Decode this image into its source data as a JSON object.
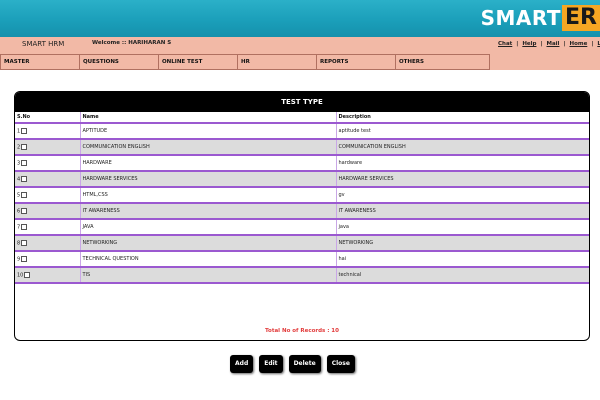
{
  "logo": {
    "part1": "SMART",
    "part2": "ER"
  },
  "header": {
    "app_name": "SMART HRM",
    "welcome": "Welcome :: HARIHARAN S",
    "links": [
      "Chat",
      "Help",
      "Mail",
      "Home",
      "L"
    ]
  },
  "menu": [
    {
      "label": "MASTER"
    },
    {
      "label": "QUESTIONS"
    },
    {
      "label": "ONLINE TEST"
    },
    {
      "label": "HR"
    },
    {
      "label": "REPORTS"
    },
    {
      "label": "OTHERS"
    }
  ],
  "table": {
    "title": "TEST TYPE",
    "columns": [
      "S.No",
      "Name",
      "Description"
    ],
    "rows": [
      {
        "sno": "1",
        "name": "APTITUDE",
        "description": "aptitude test"
      },
      {
        "sno": "2",
        "name": "COMMUNICATION ENGLISH",
        "description": "COMMUNICATION ENGLISH"
      },
      {
        "sno": "3",
        "name": "HARDWARE",
        "description": "hardware"
      },
      {
        "sno": "4",
        "name": "HARDWARE SERVICES",
        "description": "HARDWARE SERVICES"
      },
      {
        "sno": "5",
        "name": "HTML,CSS",
        "description": "gv"
      },
      {
        "sno": "6",
        "name": "IT AWARENESS",
        "description": "IT AWARENESS"
      },
      {
        "sno": "7",
        "name": "JAVA",
        "description": "java"
      },
      {
        "sno": "8",
        "name": "NETWORKING",
        "description": "NETWORKING"
      },
      {
        "sno": "9",
        "name": "TECHNICAL QUESTION",
        "description": "hai"
      },
      {
        "sno": "10",
        "name": "TIS",
        "description": "technical"
      }
    ],
    "total_records": "Total No of Records : 10"
  },
  "actions": [
    "Add",
    "Edit",
    "Delete",
    "Close"
  ],
  "colors": {
    "topbar": "#1b9fba",
    "header": "#f2b9a6",
    "row_divider": "#9b59d0",
    "records_text": "#e23a3a"
  }
}
